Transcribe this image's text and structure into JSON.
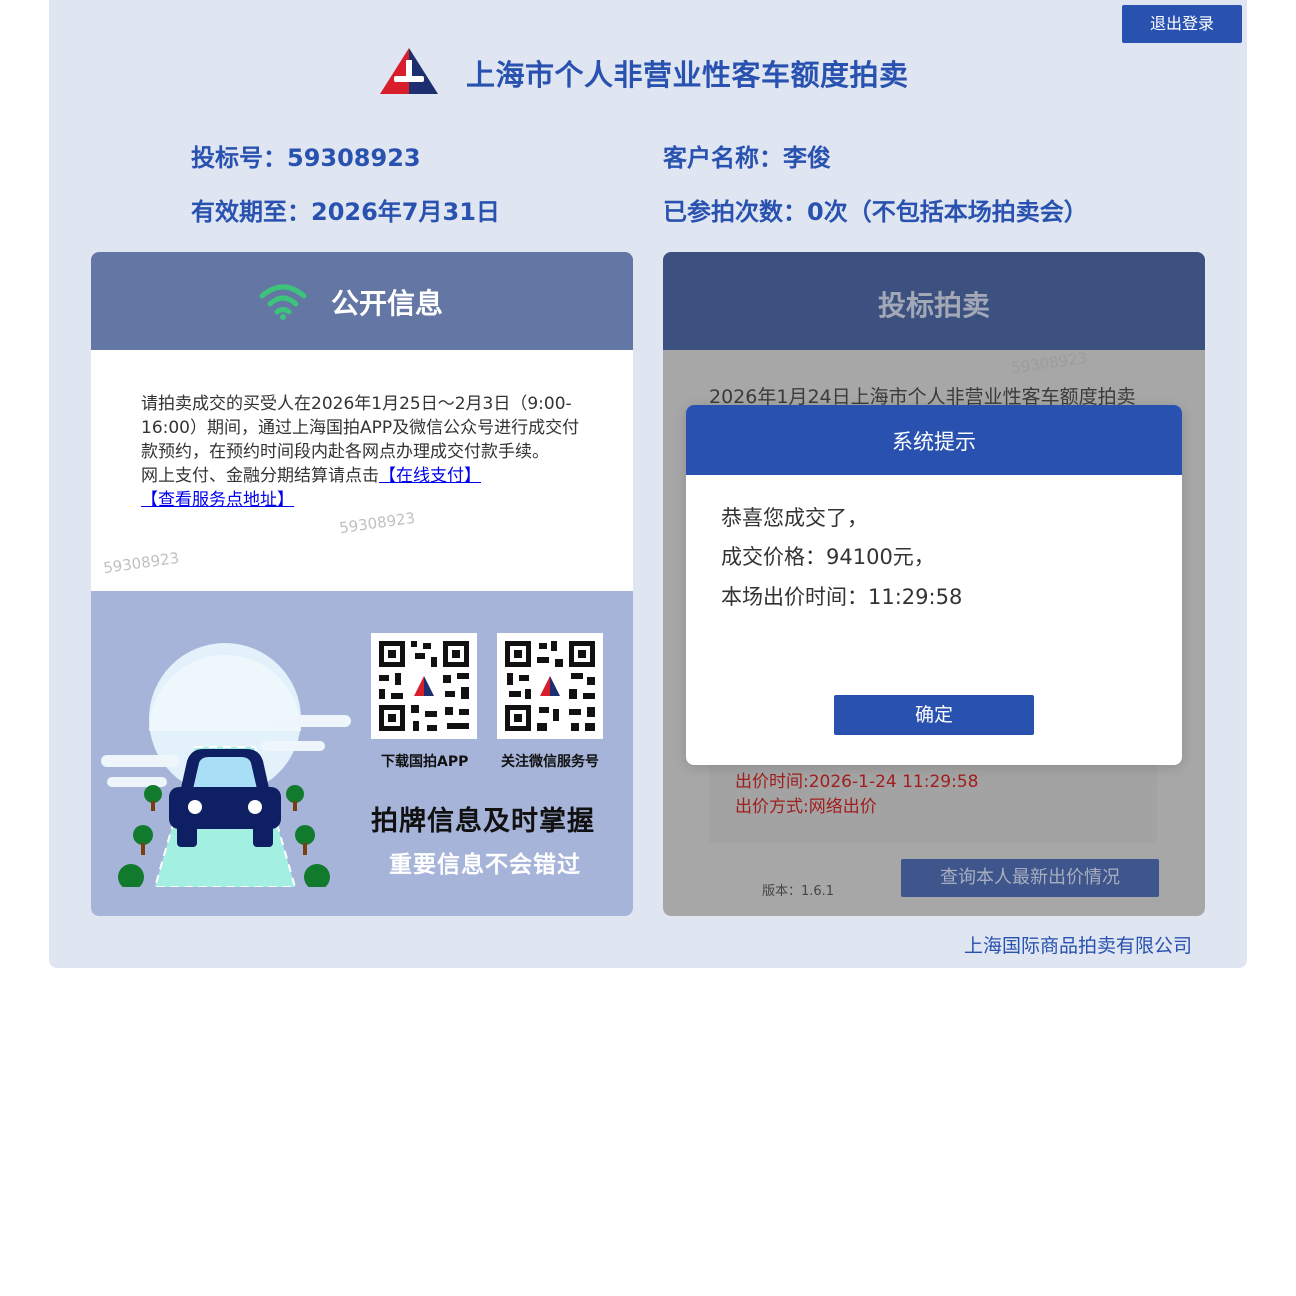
{
  "header": {
    "logout_label": "退出登录",
    "title": "上海市个人非营业性客车额度拍卖"
  },
  "account": {
    "bid_number": "投标号：59308923",
    "customer_name": "客户名称：李俊",
    "valid_until": "有效期至：2026年7月31日",
    "auction_count": "已参拍次数：0次（不包括本场拍卖会）"
  },
  "public_info": {
    "title": "公开信息",
    "notice_text": "请拍卖成交的买受人在2026年1月25日～2月3日（9:00-16:00）期间，通过上海国拍APP及微信公众号进行成交付款预约，在预约时间段内赴各网点办理成交付款手续。",
    "payment_prefix": "网上支付、金融分期结算请点击",
    "online_payment_link": "【在线支付】",
    "service_address_link": "【查看服务点地址】",
    "qr_app_label": "下载国拍APP",
    "qr_wechat_label": "关注微信服务号",
    "slogan_main": "拍牌信息及时掌握",
    "slogan_sub": "重要信息不会错过"
  },
  "bidding": {
    "title": "投标拍卖",
    "auction_title": "2026年1月24日上海市个人非营业性客车额度拍卖",
    "bid_time": "出价时间:2026-1-24 11:29:58",
    "bid_method": "出价方式:网络出价",
    "version": "版本：1.6.1",
    "query_button": "查询本人最新出价情况"
  },
  "dialog": {
    "title": "系统提示",
    "line1": "恭喜您成交了，",
    "line2": "成交价格：94100元，",
    "line3": "本场出价时间：11:29:58",
    "confirm_label": "确定"
  },
  "watermark": "59308923",
  "footer": {
    "company": "上海国际商品拍卖有限公司"
  },
  "colors": {
    "brand_blue": "#2952b0",
    "page_bg": "#dfe5f1",
    "info_header": "#6477a4",
    "bid_header": "#3c517f",
    "bid_text_red": "#a11e1e"
  }
}
